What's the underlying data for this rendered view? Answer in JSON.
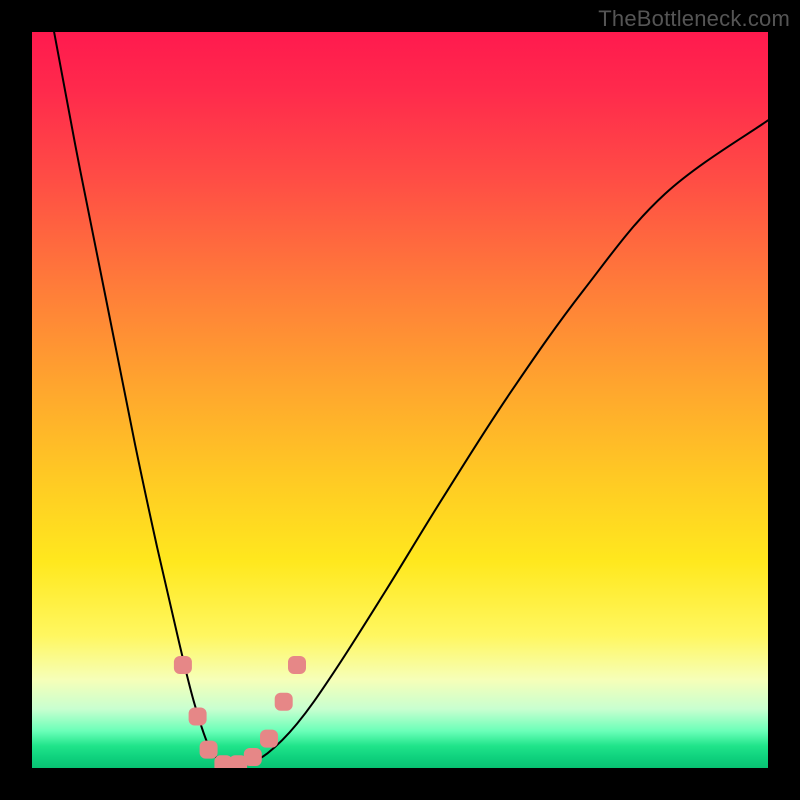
{
  "watermark": "TheBottleneck.com",
  "chart_data": {
    "type": "line",
    "title": "",
    "xlabel": "",
    "ylabel": "",
    "xlim": [
      0,
      100
    ],
    "ylim": [
      0,
      100
    ],
    "grid": false,
    "series": [
      {
        "name": "bottleneck-curve",
        "x": [
          3,
          6,
          10,
          14,
          17,
          20,
          22,
          24,
          25.5,
          27,
          29,
          32,
          36,
          41,
          48,
          56,
          65,
          75,
          86,
          100
        ],
        "y": [
          100,
          84,
          64,
          44,
          30,
          17,
          9,
          3,
          1,
          0,
          0.5,
          2,
          6,
          13,
          24,
          37,
          51,
          65,
          78,
          88
        ]
      }
    ],
    "markers": {
      "color": "#e68787",
      "points": [
        {
          "x": 20.5,
          "y": 14
        },
        {
          "x": 22.5,
          "y": 7
        },
        {
          "x": 24,
          "y": 2.5
        },
        {
          "x": 26,
          "y": 0.5
        },
        {
          "x": 28,
          "y": 0.5
        },
        {
          "x": 30,
          "y": 1.5
        },
        {
          "x": 32.2,
          "y": 4
        },
        {
          "x": 34.2,
          "y": 9
        },
        {
          "x": 36,
          "y": 14
        }
      ]
    },
    "gradient_stops": [
      {
        "pos": 0.0,
        "color": "#ff1a4e"
      },
      {
        "pos": 0.5,
        "color": "#ffbe26"
      },
      {
        "pos": 0.85,
        "color": "#fff760"
      },
      {
        "pos": 1.0,
        "color": "#08c272"
      }
    ]
  }
}
